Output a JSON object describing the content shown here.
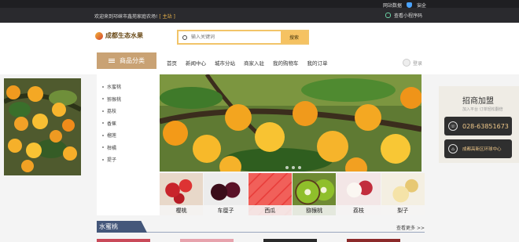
{
  "topbar": {
    "network_label": "网站数据",
    "secure_label": "安全",
    "welcome_text": "欢迎来到邛崃市鑫苑家庭农场!",
    "site_label": "[ 主站 ]",
    "mini_program_label": "查看小程序码"
  },
  "header": {
    "logo_text": "成都生态水果",
    "search_placeholder": "输入关键词",
    "search_button": "搜索"
  },
  "nav": {
    "category_label": "商品分类",
    "items": [
      "首页",
      "新闻中心",
      "城市分站",
      "商家入驻",
      "我的购物车",
      "我的订单"
    ],
    "login_label": "登录"
  },
  "categories": [
    "水蜜桃",
    "猕猴桃",
    "荔枝",
    "香蕉",
    "榴莲",
    "柑橘",
    "提子"
  ],
  "thumbnails": [
    "樱桃",
    "车厘子",
    "西瓜",
    "猕猴桃",
    "荔枝",
    "梨子"
  ],
  "sidebar": {
    "title": "招商加盟",
    "subtitle": "加入平台 订单轻松翻倍",
    "phone": "028-63851673",
    "location": "成都高新区环球中心"
  },
  "section": {
    "title": "水蜜桃",
    "more_label": "查看更多 >>"
  },
  "colors": {
    "accent_gold": "#c9a274",
    "search_border": "#f2c469",
    "section_blue": "#44577a",
    "dark_bar": "#2a2a2e"
  }
}
